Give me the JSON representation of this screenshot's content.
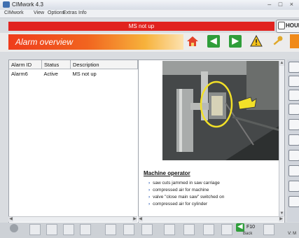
{
  "window": {
    "title": "CIMwork 4.3",
    "controls": "– □ ×"
  },
  "menu": [
    "CIMwork",
    "View",
    "Options",
    "Extras",
    "Info"
  ],
  "status": {
    "message": "MS not up",
    "home_label": "HOUR"
  },
  "header": {
    "title": "Alarm overview"
  },
  "alarm_table": {
    "columns": [
      "Alarm ID",
      "Status",
      "Description"
    ],
    "rows": [
      {
        "id": "Alarm6",
        "status": "Active",
        "description": "MS not up"
      }
    ]
  },
  "detail": {
    "section_title": "Machine operator",
    "items": [
      "saw cuts jammed in saw carriage",
      "compressed air for machine",
      "valve \"close main saw\" switched on",
      "compressed air for cylinder"
    ]
  },
  "footer": {
    "f10_label": "F10",
    "back_label": "Back",
    "version_label": "V: M"
  },
  "colors": {
    "status_red": "#e1231f",
    "banner_orange": "#ef3c1c",
    "nav_green": "#2f9e3a",
    "highlight_yellow": "#f2e028"
  }
}
